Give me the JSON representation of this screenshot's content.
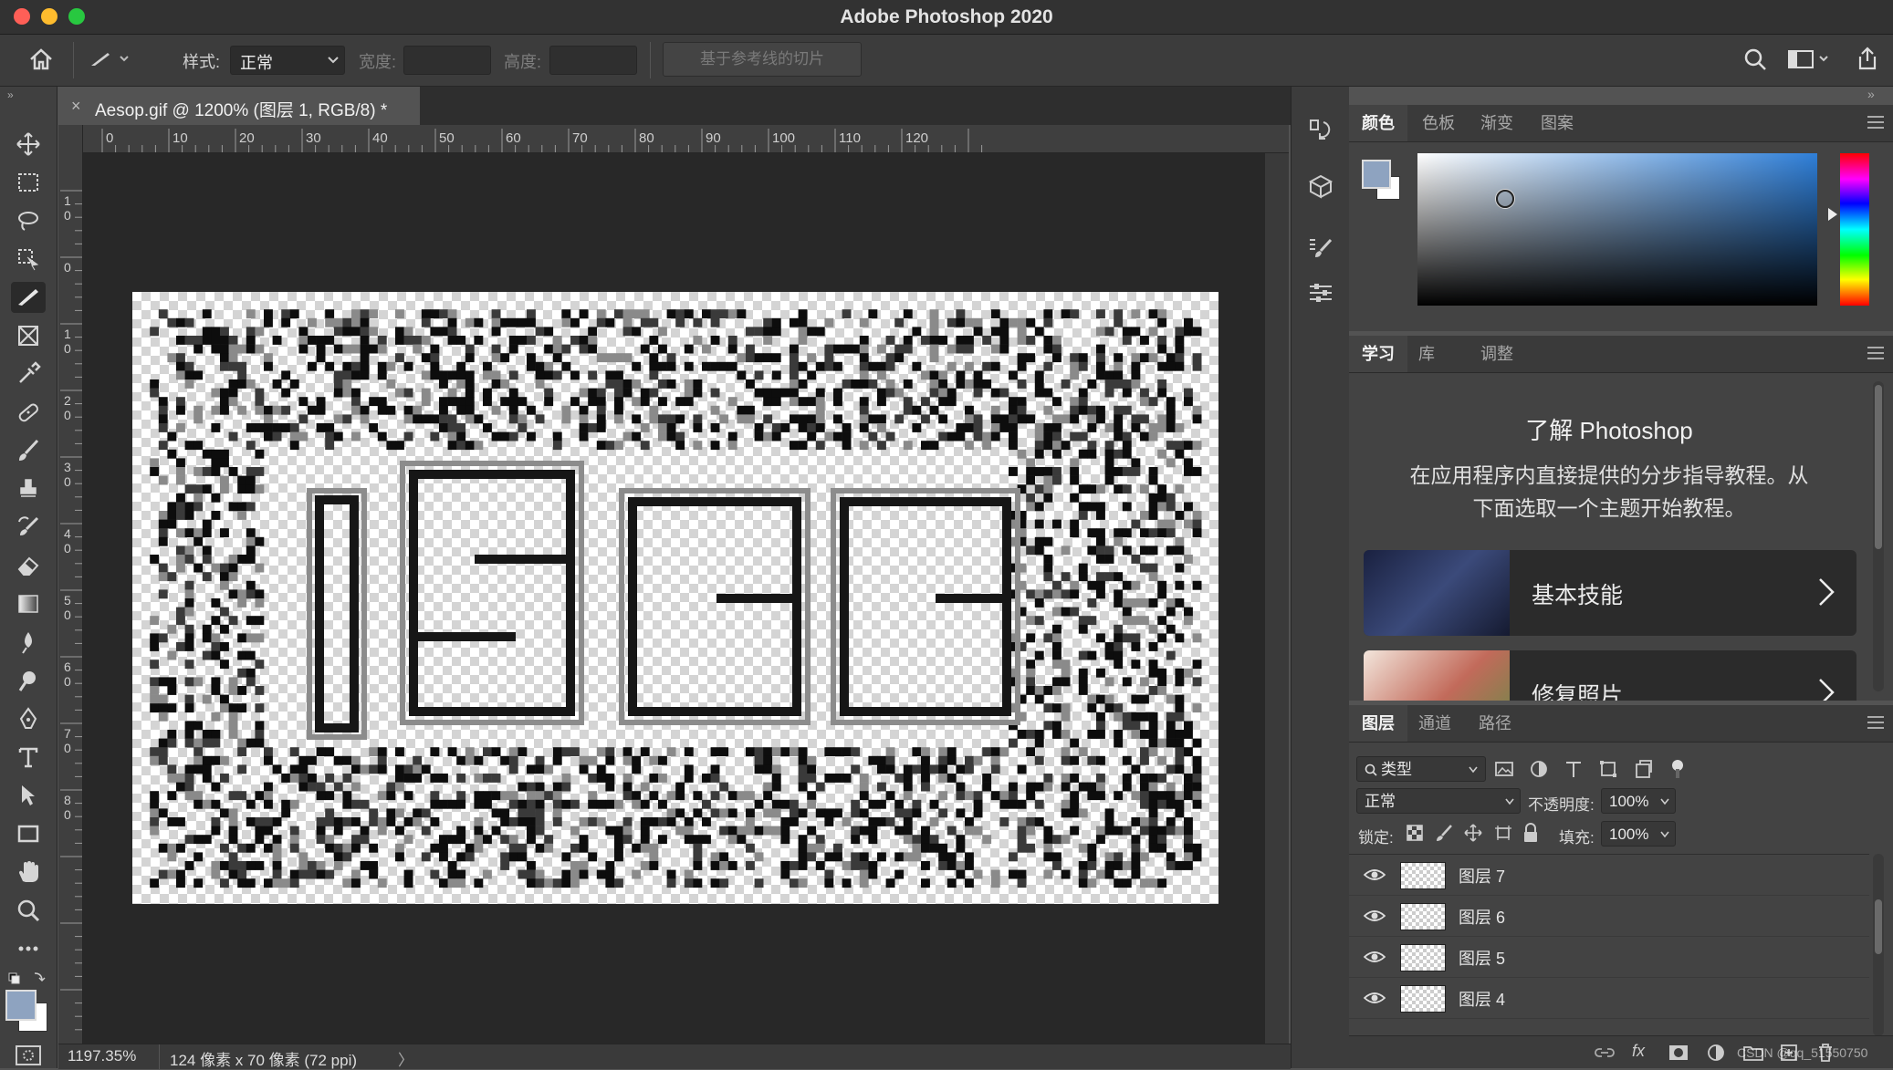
{
  "window": {
    "title": "Adobe Photoshop 2020"
  },
  "options_bar": {
    "style_label": "样式:",
    "style_value": "正常",
    "width_label": "宽度:",
    "height_label": "高度:",
    "slice_button": "基于参考线的切片"
  },
  "document": {
    "tab_title": "Aesop.gif @ 1200% (图层 1, RGB/8) *",
    "close_symbol": "×",
    "ruler_h": [
      "0",
      "10",
      "20",
      "30",
      "40",
      "50",
      "60",
      "70",
      "80",
      "90",
      "100",
      "110",
      "120"
    ],
    "ruler_v": [
      "1\n0",
      "0",
      "1\n0",
      "2\n0",
      "3\n0",
      "4\n0",
      "5\n0",
      "6\n0",
      "7\n0",
      "8\n0"
    ],
    "captcha_digits": "1530"
  },
  "status": {
    "zoom": "1197.35%",
    "doc_info": "124 像素 x 70 像素 (72 ppi)",
    "arrow": "〉"
  },
  "color_panel": {
    "tabs": [
      "颜色",
      "色板",
      "渐变",
      "图案"
    ],
    "foreground": "#8ea3c0",
    "background": "#ffffff",
    "hue": "#2f7fd8"
  },
  "learn_panel": {
    "tabs": [
      "学习",
      "库",
      "调整"
    ],
    "heading": "了解 Photoshop",
    "description_line1": "在应用程序内直接提供的分步指导教程。从",
    "description_line2": "下面选取一个主题开始教程。",
    "cards": [
      {
        "label": "基本技能"
      },
      {
        "label": "修复照片"
      }
    ]
  },
  "layers_panel": {
    "tabs": [
      "图层",
      "通道",
      "路径"
    ],
    "filter_label": "类型",
    "blend_mode": "正常",
    "opacity_label": "不透明度:",
    "opacity_value": "100%",
    "lock_label": "锁定:",
    "fill_label": "填充:",
    "fill_value": "100%",
    "layers": [
      {
        "name": "图层 7"
      },
      {
        "name": "图层 6"
      },
      {
        "name": "图层 5"
      },
      {
        "name": "图层 4"
      }
    ]
  },
  "watermark": "CSDN @qq_51550750"
}
